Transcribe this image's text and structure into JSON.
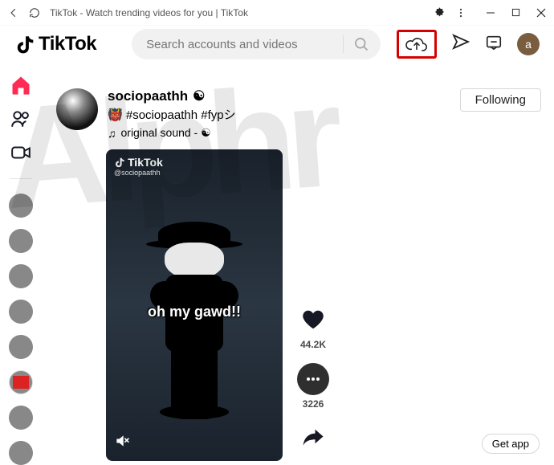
{
  "browser": {
    "title": "TikTok - Watch trending videos for you | TikTok"
  },
  "header": {
    "logo_text": "TikTok",
    "search_placeholder": "Search accounts and videos",
    "avatar_letter": "a"
  },
  "post": {
    "username": "sociopaathh",
    "caption_prefix_emoji": "👹",
    "caption_text": "#sociopaathh #fypシ",
    "sound_prefix": "♫",
    "sound_text": "original sound - ☯",
    "follow_button": "Following"
  },
  "video": {
    "wm_brand": "TikTok",
    "wm_handle": "@sociopaathh",
    "overlay_text": "oh my gawd!!"
  },
  "actions": {
    "likes": "44.2K",
    "comments": "3226"
  },
  "footer": {
    "get_app": "Get app"
  },
  "watermark": "Alphr"
}
